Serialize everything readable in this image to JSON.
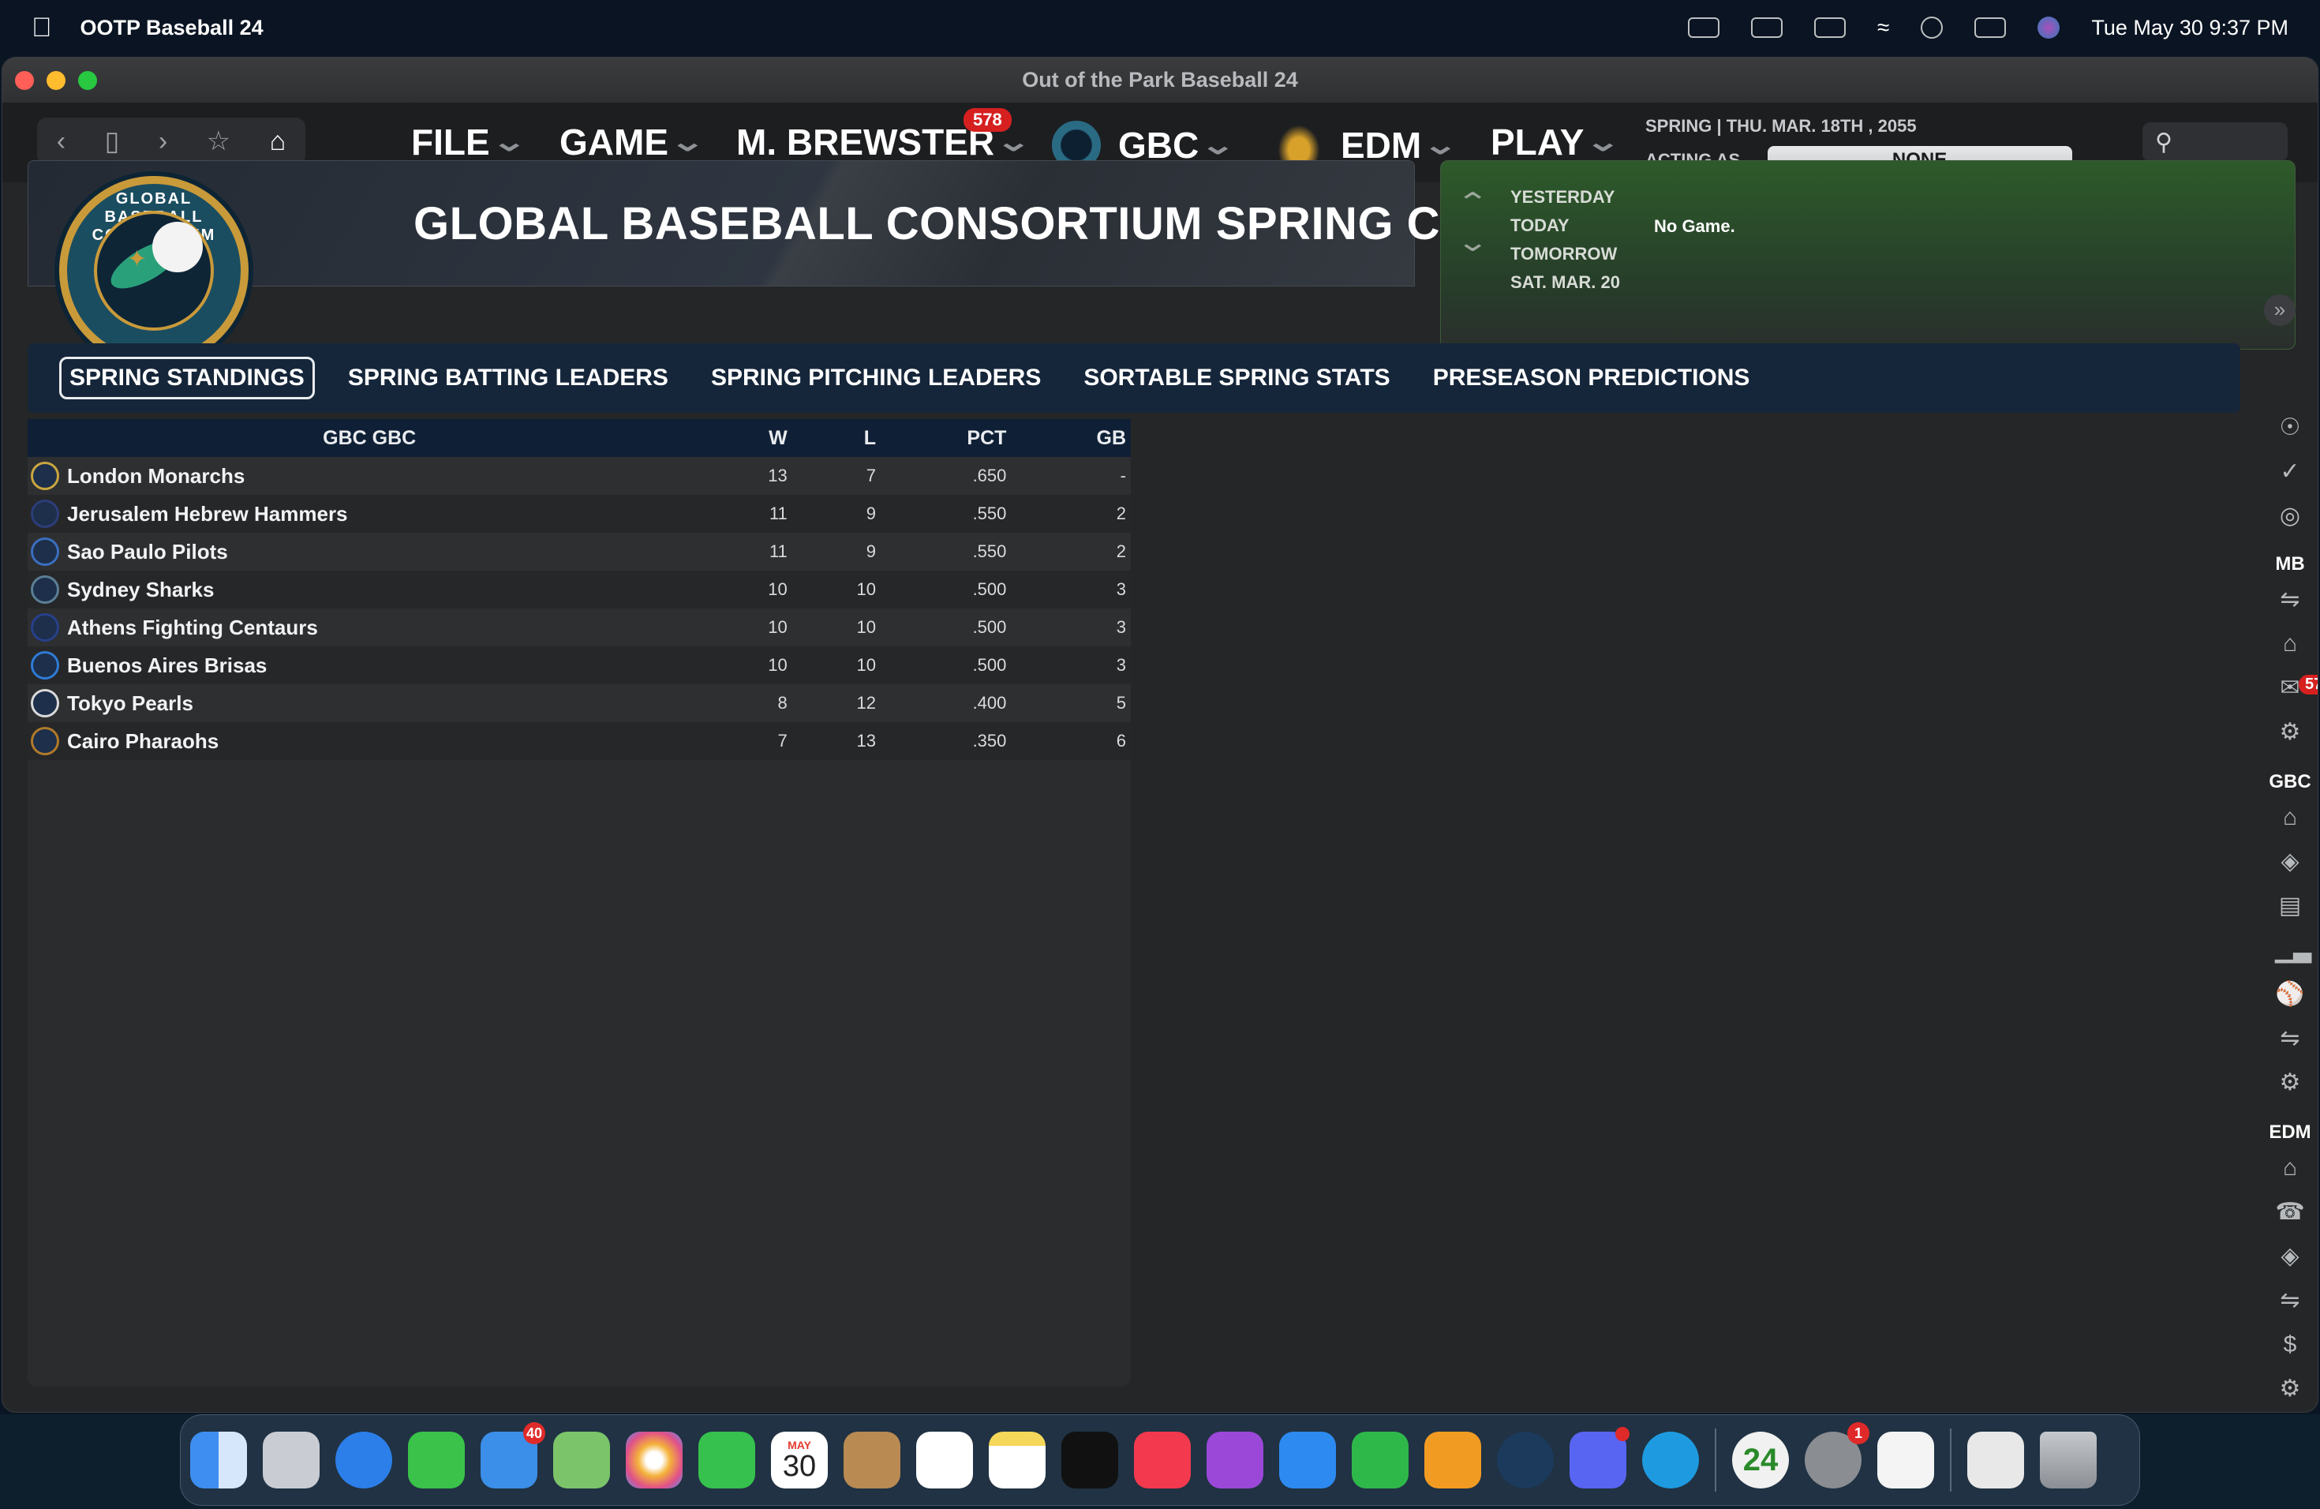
{
  "menubar": {
    "app_name": "OOTP Baseball 24",
    "clock": "Tue May 30  9:37 PM"
  },
  "window": {
    "title": "Out of the Park Baseball 24"
  },
  "nav": {
    "menus": {
      "file": "FILE",
      "game": "GAME",
      "manager": "M. BREWSTER",
      "gbc": "GBC",
      "edm": "EDM",
      "play": "PLAY"
    },
    "manager_badge": "578",
    "date_line": "SPRING  |  THU. MAR. 18TH , 2055",
    "acting_label": "ACTING AS...",
    "acting_value": "NONE"
  },
  "banner": {
    "title": "GLOBAL BASEBALL CONSORTIUM SPRING COVERAGE",
    "logo_text": "GLOBAL BASEBALL CONSORTIUM"
  },
  "schedule": {
    "yesterday": "YESTERDAY",
    "today": "TODAY",
    "tomorrow": "TOMORROW",
    "next_date": "SAT. MAR. 20",
    "status": "No Game."
  },
  "tabs": [
    {
      "label": "SPRING STANDINGS"
    },
    {
      "label": "SPRING BATTING LEADERS"
    },
    {
      "label": "SPRING PITCHING LEADERS"
    },
    {
      "label": "SORTABLE SPRING STATS"
    },
    {
      "label": "PRESEASON PREDICTIONS"
    }
  ],
  "standings": {
    "headers": {
      "team": "GBC GBC",
      "w": "W",
      "l": "L",
      "pct": "PCT",
      "gb": "GB"
    },
    "rows": [
      {
        "team": "London Monarchs",
        "w": "13",
        "l": "7",
        "pct": ".650",
        "gb": "-",
        "color": "#c9a640"
      },
      {
        "team": "Jerusalem Hebrew Hammers",
        "w": "11",
        "l": "9",
        "pct": ".550",
        "gb": "2",
        "color": "#2c3d7a"
      },
      {
        "team": "Sao Paulo Pilots",
        "w": "11",
        "l": "9",
        "pct": ".550",
        "gb": "2",
        "color": "#3a6fc0"
      },
      {
        "team": "Sydney Sharks",
        "w": "10",
        "l": "10",
        "pct": ".500",
        "gb": "3",
        "color": "#5a7f95"
      },
      {
        "team": "Athens Fighting Centaurs",
        "w": "10",
        "l": "10",
        "pct": ".500",
        "gb": "3",
        "color": "#27408b"
      },
      {
        "team": "Buenos Aires Brisas",
        "w": "10",
        "l": "10",
        "pct": ".500",
        "gb": "3",
        "color": "#2e7bd6"
      },
      {
        "team": "Tokyo Pearls",
        "w": "8",
        "l": "12",
        "pct": ".400",
        "gb": "5",
        "color": "#d9d9d9"
      },
      {
        "team": "Cairo Pharaohs",
        "w": "7",
        "l": "13",
        "pct": ".350",
        "gb": "6",
        "color": "#b07a2a"
      }
    ]
  },
  "rail": {
    "mb_label": "MB",
    "gbc_label": "GBC",
    "edm_label": "EDM",
    "mail_badge": "57"
  },
  "dock": {
    "mail_badge": "40",
    "calendar_month": "MAY",
    "calendar_day": "30",
    "ootp_label": "24",
    "settings_badge": "1"
  }
}
